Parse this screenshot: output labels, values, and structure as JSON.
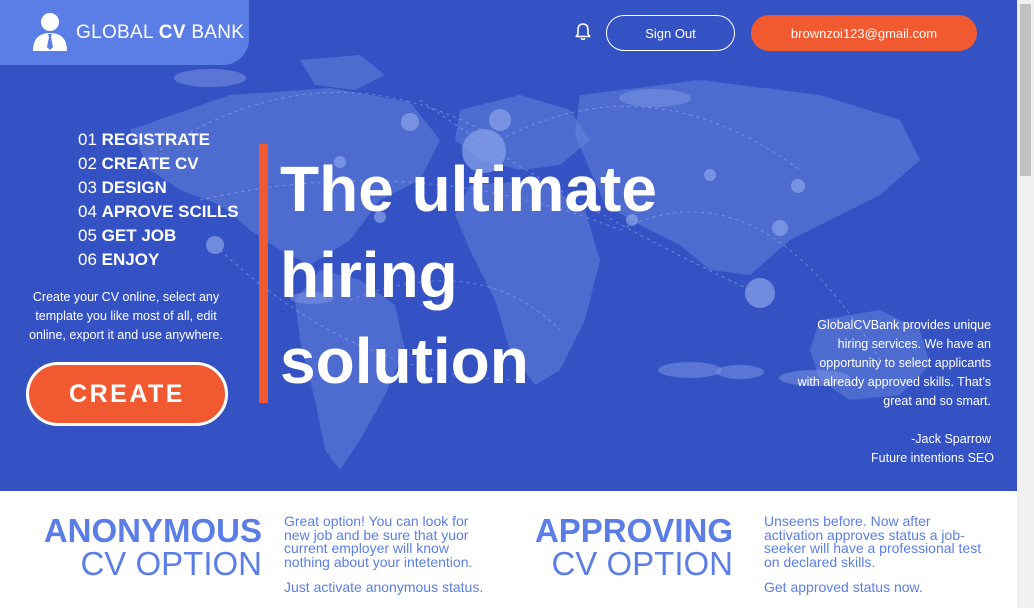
{
  "header": {
    "logo_word1": "GLOBAL",
    "logo_word2": "CV",
    "logo_word3": "BANK",
    "sign_out": "Sign Out",
    "email": "brownzoi123@gmail.com"
  },
  "steps": [
    {
      "num": "01",
      "label": "REGISTRATE"
    },
    {
      "num": "02",
      "label": "CREATE CV"
    },
    {
      "num": "03",
      "label": "DESIGN"
    },
    {
      "num": "04",
      "label": "APROVE SCILLS"
    },
    {
      "num": "05",
      "label": "GET JOB"
    },
    {
      "num": "06",
      "label": "ENJOY"
    }
  ],
  "left_description": "Create your CV online, select any template you like most of all, edit online, export it and use anywhere.",
  "create_button": "CREATE",
  "headline": [
    "The ultimate",
    "hiring",
    "solution"
  ],
  "quote": {
    "text": "GlobalCVBank provides unique hiring services. We have an opportunity to select applicants with already approved skills. That’s great and so smart.",
    "author": "-Jack Sparrow",
    "role": "Future intentions SEO"
  },
  "features": [
    {
      "title_bold": "ANONYMOUS",
      "title_thin": "CV OPTION",
      "text": "Great option! You can look for new job and be sure that yuor current employer will know nothing about your intetention.",
      "cta": "Just activate anonymous status."
    },
    {
      "title_bold": "APPROVING",
      "title_thin": "CV OPTION",
      "text": "Unseens before. Now after activation approves status a job-seeker will have a professional test on declared skills.",
      "cta": "Get approved status now."
    }
  ],
  "icons": [
    "user-logo-icon",
    "bell-icon",
    "world-map-icon"
  ],
  "colors": {
    "hero_bg": "#3452c4",
    "logo_bg": "#5b7ee6",
    "accent": "#f15a31",
    "feature_text": "#5b7ee6"
  }
}
